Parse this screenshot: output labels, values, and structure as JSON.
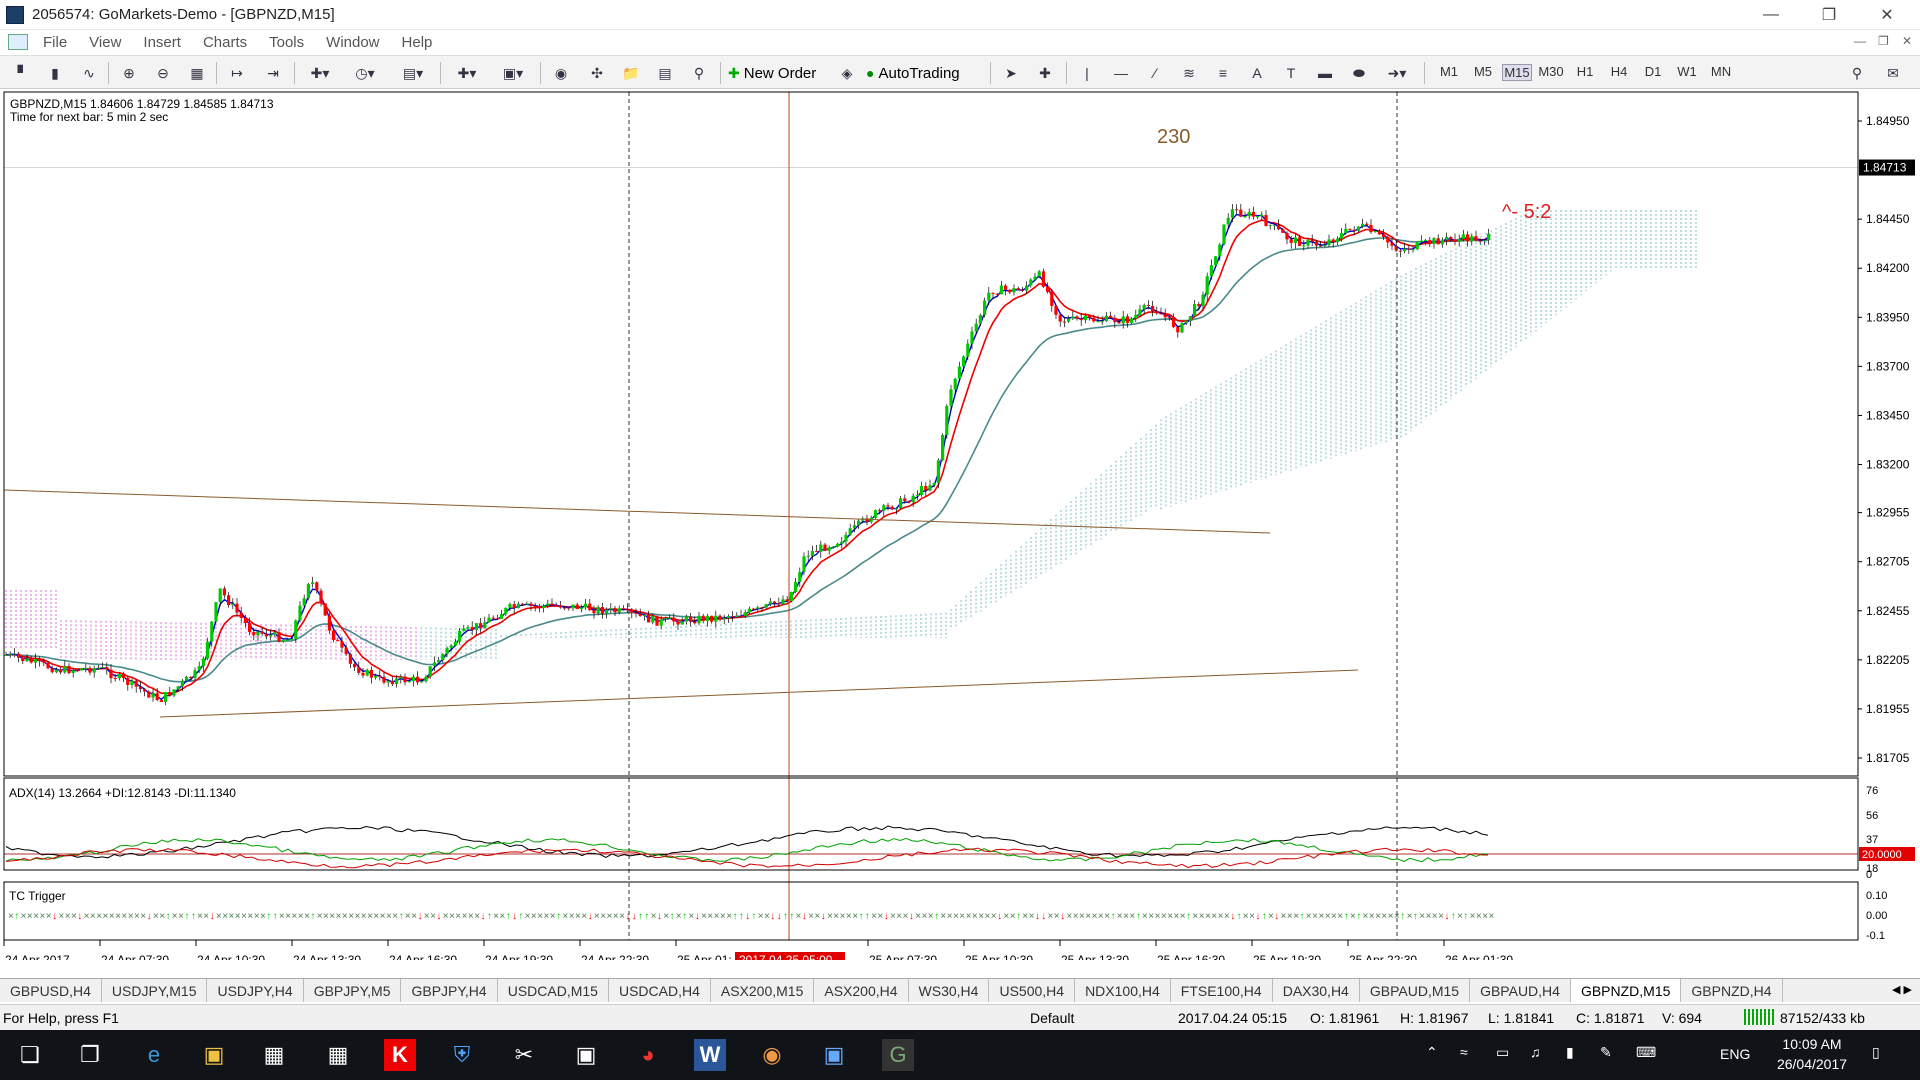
{
  "window": {
    "title": "2056574: GoMarkets-Demo - [GBPNZD,M15]"
  },
  "menu": {
    "items": [
      "File",
      "View",
      "Insert",
      "Charts",
      "Tools",
      "Window",
      "Help"
    ]
  },
  "toolbar": {
    "new_order": "New Order",
    "autotrading": "AutoTrading",
    "timeframes": [
      "M1",
      "M5",
      "M15",
      "M30",
      "H1",
      "H4",
      "D1",
      "W1",
      "MN"
    ],
    "active_timeframe": "M15"
  },
  "chart": {
    "symbol_info": "GBPNZD,M15  1.84606 1.84729 1.84585 1.84713",
    "next_bar": "Time for next bar: 5 min 2 sec",
    "annotation_230": "230",
    "annotation_ratio": "^- 5:2",
    "price_labels": [
      "1.84950",
      "1.84713",
      "1.84450",
      "1.84200",
      "1.83950",
      "1.83700",
      "1.83450",
      "1.83200",
      "1.82955",
      "1.82705",
      "1.82455",
      "1.82205",
      "1.81955",
      "1.81705"
    ],
    "current_price": "1.84713",
    "adx_label": "ADX(14) 13.2664 +DI:12.8143 -DI:11.1340",
    "adx_scale": [
      "76",
      "56",
      "37",
      "20.0000",
      "18",
      "0"
    ],
    "tc_label": "TC Trigger",
    "tc_scale": [
      "0.10",
      "0.00",
      "-0.1"
    ],
    "time_labels": [
      "24 Apr 2017",
      "24 Apr 07:30",
      "24 Apr 10:30",
      "24 Apr 13:30",
      "24 Apr 16:30",
      "24 Apr 19:30",
      "24 Apr 22:30",
      "25 Apr 01:",
      "25 Apr 07:30",
      "25 Apr 10:30",
      "25 Apr 13:30",
      "25 Apr 16:30",
      "25 Apr 19:30",
      "25 Apr 22:30",
      "26 Apr 01:30"
    ],
    "cursor_time": "2017.04.25 05:00",
    "colors": {
      "bull": "#00c800",
      "bear": "#ff0000",
      "fast_ma": "#0000cc",
      "mid_ma": "#ee0000",
      "slow_ma": "#4a8a8a",
      "cloud_a": "#40a0b0",
      "cloud_b": "#cc33cc",
      "trend": "#8b5a2b",
      "adx": "#000000",
      "plus_di": "#00a000",
      "minus_di": "#d00000"
    }
  },
  "tabs": [
    "GBPUSD,H4",
    "USDJPY,M15",
    "USDJPY,H4",
    "GBPJPY,M5",
    "GBPJPY,H4",
    "USDCAD,M15",
    "USDCAD,H4",
    "ASX200,M15",
    "ASX200,H4",
    "WS30,H4",
    "US500,H4",
    "NDX100,H4",
    "FTSE100,H4",
    "DAX30,H4",
    "GBPAUD,M15",
    "GBPAUD,H4",
    "GBPNZD,M15",
    "GBPNZD,H4"
  ],
  "active_tab": "GBPNZD,M15",
  "status": {
    "help": "For Help, press F1",
    "profile": "Default",
    "time": "2017.04.24 05:15",
    "open": "O: 1.81961",
    "high": "H: 1.81967",
    "low": "L: 1.81841",
    "close": "C: 1.81871",
    "volume": "V: 694",
    "traffic": "87152/433 kb"
  },
  "taskbar": {
    "lang": "ENG",
    "clock_time": "10:09 AM",
    "clock_date": "26/04/2017"
  }
}
